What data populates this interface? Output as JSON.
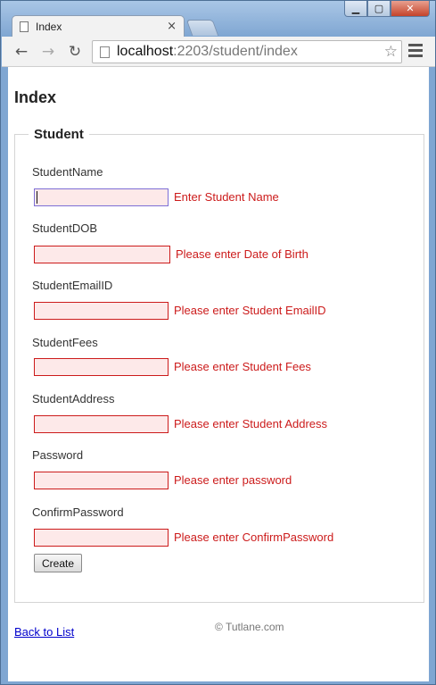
{
  "browser": {
    "tab_title": "Index",
    "tab_close": "×",
    "url_host": "localhost",
    "url_rest": ":2203/student/index",
    "controls": {
      "minimize": "▁",
      "maximize": "▢",
      "close": "✕"
    },
    "nav": {
      "back": "←",
      "forward": "→",
      "reload": "↻",
      "star": "☆"
    }
  },
  "page": {
    "title": "Index",
    "legend": "Student",
    "fields": [
      {
        "label": "StudentName",
        "error": "Enter Student Name",
        "focused": true
      },
      {
        "label": "StudentDOB",
        "error": "Please enter Date of Birth"
      },
      {
        "label": "StudentEmailID",
        "error": "Please enter Student EmailID"
      },
      {
        "label": "StudentFees",
        "error": "Please enter Student Fees"
      },
      {
        "label": "StudentAddress",
        "error": "Please enter Student Address"
      },
      {
        "label": "Password",
        "error": "Please enter password"
      },
      {
        "label": "ConfirmPassword",
        "error": "Please enter ConfirmPassword"
      }
    ],
    "create_label": "Create",
    "back_link": "Back to List",
    "footer": "© Tutlane.com"
  },
  "colors": {
    "error": "#cc1b1b",
    "input_bg": "#fde9e9",
    "focus_border": "#7d6fd6",
    "link": "#0000cc"
  }
}
